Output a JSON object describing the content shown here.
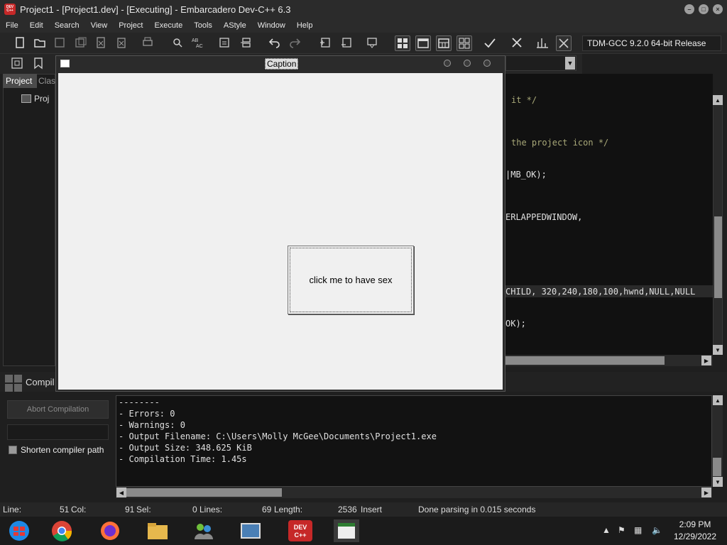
{
  "window": {
    "title": "Project1 - [Project1.dev] - [Executing] - Embarcadero Dev-C++ 6.3",
    "icon_text": "DEV C++"
  },
  "menu": [
    "File",
    "Edit",
    "Search",
    "View",
    "Project",
    "Execute",
    "Tools",
    "AStyle",
    "Window",
    "Help"
  ],
  "toolbar": {
    "compiler": "TDM-GCC 9.2.0 64-bit Release"
  },
  "left_panel": {
    "tabs": [
      "Project",
      "Clas"
    ],
    "tree_item": "Proj"
  },
  "editor": {
    "lines": [
      {
        "text": "it */",
        "kind": "comment"
      },
      {
        "text": "the project icon */",
        "kind": "comment"
      },
      {
        "text": "|MB_OK);",
        "kind": "code"
      },
      {
        "text": "ERLAPPEDWINDOW,",
        "kind": "code"
      },
      {
        "text": "CHILD, 320,240,180,100,hwnd,NULL,NULL",
        "kind": "code"
      },
      {
        "text": "OK);",
        "kind": "code"
      }
    ]
  },
  "app_window": {
    "caption": "Caption",
    "button_label": "click me to have sex"
  },
  "compiler_panel": {
    "tab_label": "Compil",
    "abort_label": "Abort Compilation",
    "shorten_label": "Shorten compiler path",
    "shorten_checked": false,
    "log": [
      "--------",
      "- Errors: 0",
      "- Warnings: 0",
      "- Output Filename: C:\\Users\\Molly McGee\\Documents\\Project1.exe",
      "- Output Size: 348.625 KiB",
      "- Compilation Time: 1.45s"
    ]
  },
  "status": {
    "line_label": "Line:",
    "line_value": "51",
    "col_label": "Col:",
    "col_value": "91",
    "sel_label": "Sel:",
    "sel_value": "0",
    "lines_label": "Lines:",
    "lines_value": "69",
    "length_label": "Length:",
    "length_value": "2536",
    "mode": "Insert",
    "message": "Done parsing in 0.015 seconds"
  },
  "taskbar": {
    "devcpp_text": "DEV C++",
    "time": "2:09 PM",
    "date": "12/29/2022"
  }
}
